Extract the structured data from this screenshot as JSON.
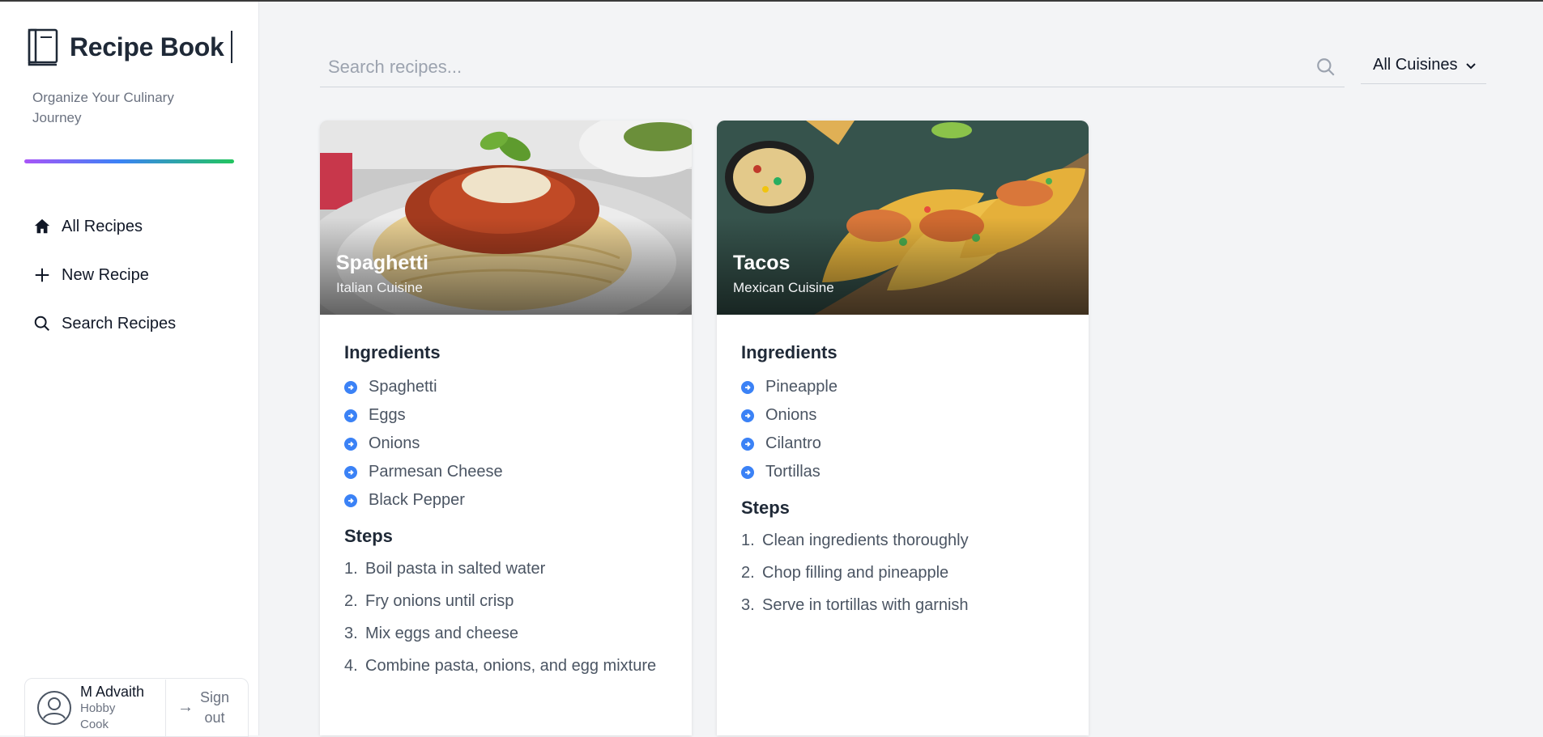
{
  "sidebar": {
    "brand": "Recipe Book",
    "tagline": "Organize Your Culinary Journey",
    "nav": [
      {
        "label": "All Recipes",
        "icon": "home-icon"
      },
      {
        "label": "New Recipe",
        "icon": "plus-icon"
      },
      {
        "label": "Search Recipes",
        "icon": "search-icon"
      }
    ],
    "user": {
      "name": "M Advaith",
      "role": "Hobby Cook",
      "signout": "Sign out"
    }
  },
  "toolbar": {
    "search_placeholder": "Search recipes...",
    "search_value": "",
    "cuisine_filter": "All Cuisines"
  },
  "recipes": [
    {
      "title": "Spaghetti",
      "cuisine": "Italian Cuisine",
      "ingredients_heading": "Ingredients",
      "ingredients": [
        "Spaghetti",
        "Eggs",
        "Onions",
        "Parmesan Cheese",
        "Black Pepper"
      ],
      "steps_heading": "Steps",
      "steps": [
        "Boil pasta in salted water",
        "Fry onions until crisp",
        "Mix eggs and cheese",
        "Combine pasta, onions, and egg mixture"
      ]
    },
    {
      "title": "Tacos",
      "cuisine": "Mexican Cuisine",
      "ingredients_heading": "Ingredients",
      "ingredients": [
        "Pineapple",
        "Onions",
        "Cilantro",
        "Tortillas"
      ],
      "steps_heading": "Steps",
      "steps": [
        "Clean ingredients thoroughly",
        "Chop filling and pineapple",
        "Serve in tortillas with garnish"
      ]
    }
  ],
  "colors": {
    "accent_blue": "#3b82f6",
    "gradient": [
      "#a855f7",
      "#3b82f6",
      "#22c55e"
    ]
  }
}
